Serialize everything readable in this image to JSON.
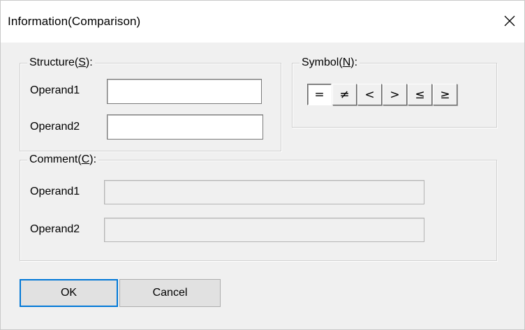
{
  "dialog": {
    "title": "Information(Comparison)",
    "close_icon": "close-icon"
  },
  "structure": {
    "legend_prefix": "Structure(",
    "legend_mnemonic": "S",
    "legend_suffix": "):",
    "operand1_label": "Operand1",
    "operand1_value": "",
    "operand2_label": "Operand2",
    "operand2_value": ""
  },
  "symbol": {
    "legend_prefix": "Symbol(",
    "legend_mnemonic": "N",
    "legend_suffix": "):",
    "selected": "=",
    "buttons": [
      "=",
      "≠",
      "<",
      ">",
      "≤",
      "≥"
    ]
  },
  "comment": {
    "legend_prefix": "Comment(",
    "legend_mnemonic": "C",
    "legend_suffix": "):",
    "operand1_label": "Operand1",
    "operand1_value": "",
    "operand2_label": "Operand2",
    "operand2_value": ""
  },
  "actions": {
    "ok_label": "OK",
    "cancel_label": "Cancel"
  },
  "colors": {
    "dialog_bg": "#f0f0f0",
    "default_button_border": "#0078d7"
  }
}
